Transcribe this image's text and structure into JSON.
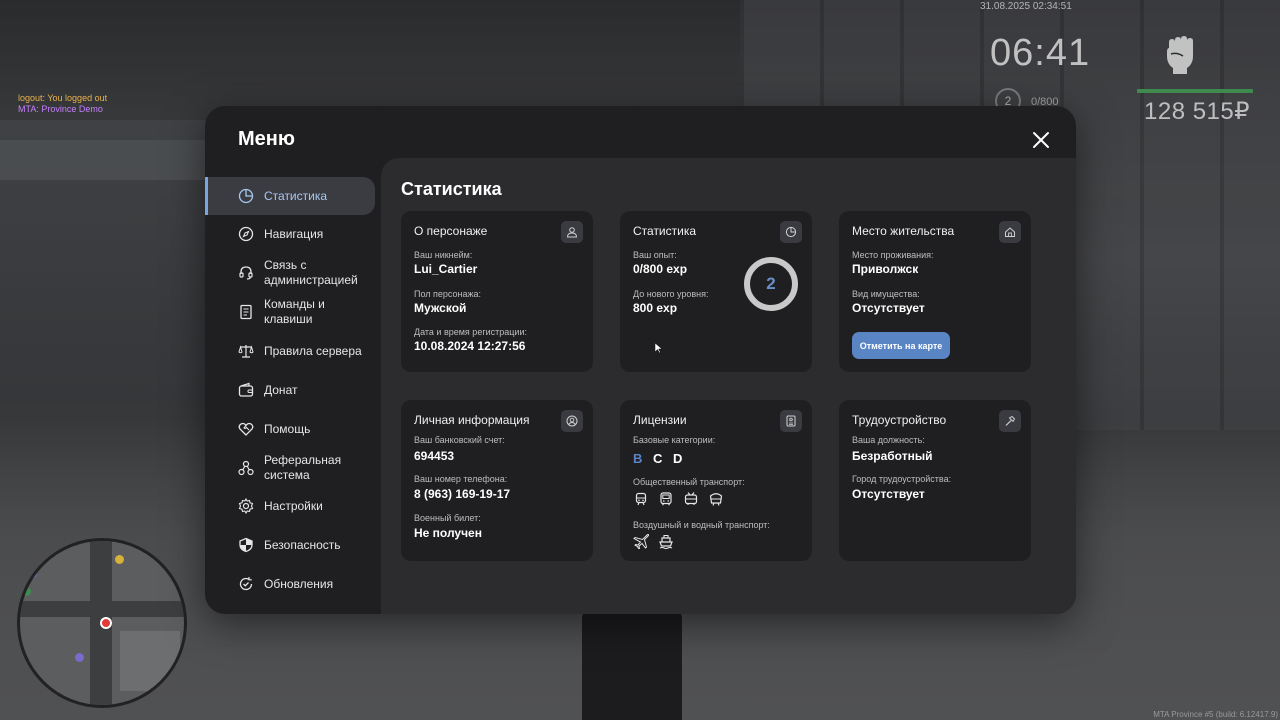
{
  "hud": {
    "datetime": "31.08.2025 02:34:51",
    "clock": "06:41",
    "level": "2",
    "exp": "0/800",
    "money": "128 515₽",
    "health_color": "#3e8a4f"
  },
  "chat": {
    "line1": "logout: You logged out",
    "line2": "MTA: Province Demo"
  },
  "build_info": "MTA Province #5 (build: 6.12417.9)",
  "menu": {
    "title": "Меню",
    "nav": [
      {
        "label": "Статистика",
        "icon": "pie-chart-icon",
        "active": true
      },
      {
        "label": "Навигация",
        "icon": "compass-icon"
      },
      {
        "label": "Связь с администрацией",
        "icon": "headset-icon"
      },
      {
        "label": "Команды и клавиши",
        "icon": "document-icon"
      },
      {
        "label": "Правила сервера",
        "icon": "scales-icon"
      },
      {
        "label": "Донат",
        "icon": "wallet-icon"
      },
      {
        "label": "Помощь",
        "icon": "heart-handshake-icon"
      },
      {
        "label": "Реферальная система",
        "icon": "referral-icon"
      },
      {
        "label": "Настройки",
        "icon": "gear-icon"
      },
      {
        "label": "Безопасность",
        "icon": "shield-icon"
      },
      {
        "label": "Обновления",
        "icon": "refresh-check-icon"
      }
    ],
    "accent": "#7aa6e0"
  },
  "content": {
    "title": "Статистика",
    "character": {
      "title": "О персонаже",
      "nickname_label": "Ваш никнейм:",
      "nickname": "Lui_Cartier",
      "gender_label": "Пол персонажа:",
      "gender": "Мужской",
      "reg_label": "Дата и время регистрации:",
      "reg": "10.08.2024 12:27:56"
    },
    "stats": {
      "title": "Статистика",
      "exp_label": "Ваш опыт:",
      "exp": "0/800 exp",
      "next_label": "До нового уровня:",
      "next": "800 exp",
      "level": "2"
    },
    "residence": {
      "title": "Место жительства",
      "place_label": "Место проживания:",
      "place": "Приволжск",
      "property_label": "Вид имущества:",
      "property": "Отсутствует",
      "map_button": "Отметить на карте"
    },
    "personal": {
      "title": "Личная информация",
      "bank_label": "Ваш банковский счет:",
      "bank": "694453",
      "phone_label": "Ваш номер телефона:",
      "phone": "8 (963) 169-19-17",
      "military_label": "Военный билет:",
      "military": "Не получен"
    },
    "licenses": {
      "title": "Лицензии",
      "base_label": "Базовые категории:",
      "categories": [
        {
          "label": "B",
          "color": "#5a85c4"
        },
        {
          "label": "C",
          "color": "#ffffff"
        },
        {
          "label": "D",
          "color": "#ffffff"
        }
      ],
      "public_label": "Общественный транспорт:",
      "air_label": "Воздушный и водный транспорт:"
    },
    "employment": {
      "title": "Трудоустройство",
      "position_label": "Ваша должность:",
      "position": "Безработный",
      "city_label": "Город трудоустройства:",
      "city": "Отсутствует"
    }
  }
}
